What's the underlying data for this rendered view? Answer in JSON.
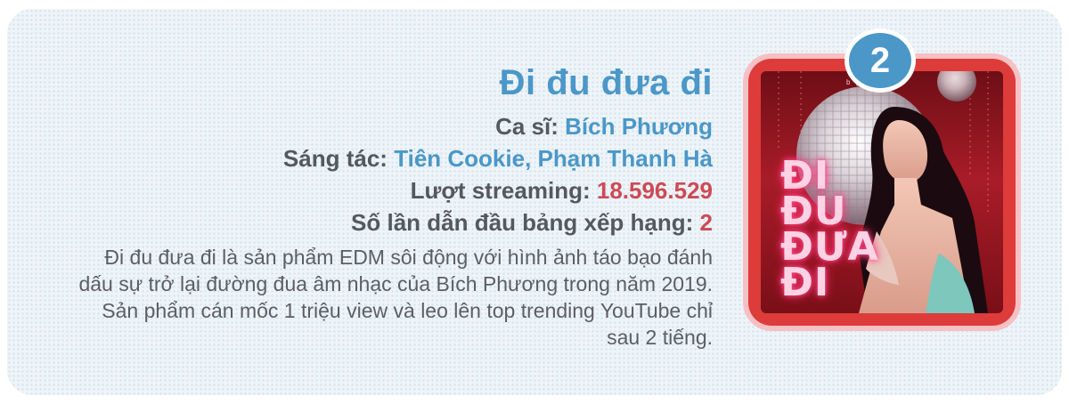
{
  "song": {
    "rank": "2",
    "title": "Đi đu đưa đi",
    "singer_label": "Ca sĩ:",
    "singer": "Bích Phương",
    "composer_label": "Sáng tác:",
    "composer": "Tiên Cookie, Phạm Thanh Hà",
    "streams_label": "Lượt streaming:",
    "streams": "18.596.529",
    "chart_label": "Số lần dẫn đầu bảng xếp hạng:",
    "chart_count": "2",
    "description": "Đi đu đưa đi là sản phẩm EDM sôi động với hình ảnh táo bạo đánh dấu sự trở lại đường đua âm nhạc của Bích Phương trong năm 2019. Sản phẩm cán mốc 1 triệu view và leo lên top trending YouTube chỉ sau 2 tiếng."
  },
  "cover": {
    "top_text": "b            g",
    "lines": [
      "ĐI",
      "ĐU",
      "ĐƯA",
      "ĐI"
    ]
  },
  "colors": {
    "accent_blue": "#4b97c8",
    "accent_red": "#cd4a55",
    "frame_red": "#dd3c3a"
  }
}
